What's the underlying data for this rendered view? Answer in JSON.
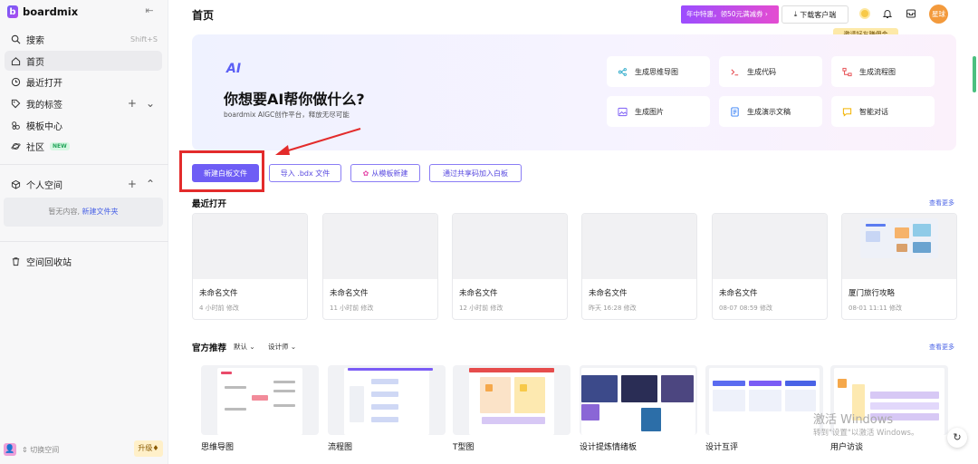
{
  "brand": {
    "name": "boardmix",
    "logo_letter": "b"
  },
  "sidebar": {
    "items": [
      {
        "label": "搜索",
        "shortcut": "Shift+S"
      },
      {
        "label": "首页"
      },
      {
        "label": "最近打开"
      },
      {
        "label": "我的标签"
      },
      {
        "label": "模板中心"
      },
      {
        "label": "社区",
        "badge": "NEW"
      }
    ],
    "personal_space": "个人空间",
    "empty_text": "暂无内容,",
    "new_folder": "新建文件夹",
    "trash": "空间回收站",
    "switch_space": "切换空间",
    "upgrade": "升级"
  },
  "header": {
    "title": "首页",
    "promo": "年中特惠，领50元满减券 ›",
    "download": "下载客户端",
    "user_label": "星球",
    "tooltip": "邀请好友赚佣金"
  },
  "hero": {
    "logo": "AI",
    "title": "你想要AI帮你做什么?",
    "subtitle": "boardmix AIGC创作平台，释放无尽可能",
    "cards": [
      {
        "label": "生成思维导图",
        "icon": "mindmap-icon",
        "color": "#2aa9c9"
      },
      {
        "label": "生成代码",
        "icon": "code-icon",
        "color": "#e5484d"
      },
      {
        "label": "生成流程图",
        "icon": "flowchart-icon",
        "color": "#e5484d"
      },
      {
        "label": "生成图片",
        "icon": "image-icon",
        "color": "#7b5cf5"
      },
      {
        "label": "生成演示文稿",
        "icon": "slides-icon",
        "color": "#2f7cf6"
      },
      {
        "label": "智能对话",
        "icon": "chat-icon",
        "color": "#f2b300"
      }
    ]
  },
  "actions": {
    "new_board": "新建白板文件",
    "import": "导入 .bdx 文件",
    "from_template": "从模板新建",
    "join": "通过共享码加入白板"
  },
  "recent": {
    "title": "最近打开",
    "see_more": "查看更多",
    "files": [
      {
        "name": "未命名文件",
        "time": "4 小时前 修改"
      },
      {
        "name": "未命名文件",
        "time": "11 小时前 修改"
      },
      {
        "name": "未命名文件",
        "time": "12 小时前 修改"
      },
      {
        "name": "未命名文件",
        "time": "昨天 16:28 修改"
      },
      {
        "name": "未命名文件",
        "time": "08-07 08:59 修改"
      },
      {
        "name": "厦门旅行攻略",
        "time": "08-01 11:11 修改"
      }
    ]
  },
  "official": {
    "title": "官方推荐",
    "filter_default": "默认",
    "filter_designer": "设计师",
    "see_more": "查看更多",
    "templates": [
      "思维导图",
      "流程图",
      "T型图",
      "设计提炼情绪板",
      "设计互评",
      "用户访谈"
    ]
  },
  "watermark": {
    "line1": "激活 Windows",
    "line2": "转到\"设置\"以激活 Windows。"
  },
  "colors": {
    "accent": "#6e5df5",
    "highlight": "#e32b2b",
    "link": "#4a63e6"
  }
}
